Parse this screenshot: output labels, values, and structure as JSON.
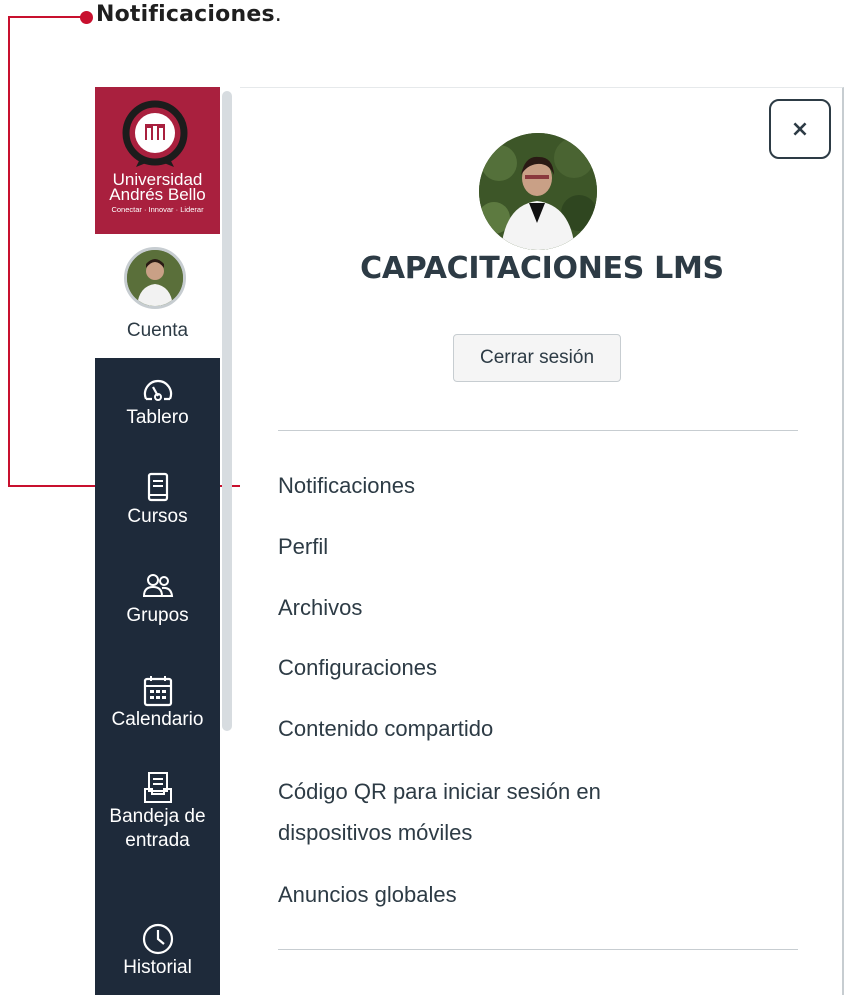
{
  "callout": {
    "label": "Notificaciones",
    "punct": ".",
    "color": "#c8102e"
  },
  "brand": {
    "line1": "Universidad",
    "line2": "Andrés Bello",
    "tagline": "Conectar · Innovar · Liderar",
    "color": "#a9203e"
  },
  "nav": {
    "account_label": "Cuenta",
    "items": [
      {
        "label": "Tablero",
        "icon": "dashboard-icon"
      },
      {
        "label": "Cursos",
        "icon": "courses-icon"
      },
      {
        "label": "Grupos",
        "icon": "groups-icon"
      },
      {
        "label": "Calendario",
        "icon": "calendar-icon"
      },
      {
        "label": "Bandeja de",
        "label2": "entrada",
        "icon": "inbox-icon"
      },
      {
        "label": "Historial",
        "icon": "history-icon"
      }
    ],
    "dark_color": "#1e2a3a"
  },
  "tray": {
    "close_label": "×",
    "user_name": "CAPACITACIONES LMS",
    "logout_label": "Cerrar sesión",
    "links": [
      "Notificaciones",
      "Perfil",
      "Archivos",
      "Configuraciones",
      "Contenido compartido",
      "Código QR para iniciar sesión en",
      "dispositivos móviles",
      "Anuncios globales"
    ]
  }
}
